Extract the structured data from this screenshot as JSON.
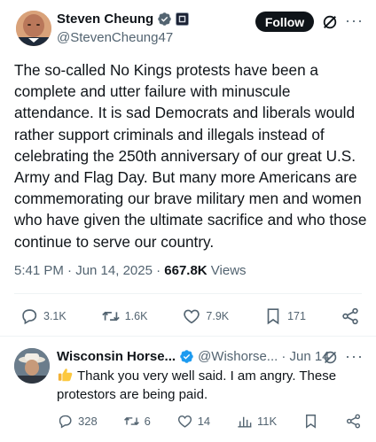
{
  "post": {
    "author_name": "Steven Cheung",
    "author_handle": "@StevenCheung47",
    "follow_label": "Follow",
    "more_label": "···",
    "text": "The so-called No Kings protests have been a complete and utter failure with minuscule attendance. It is sad Democrats and liberals would rather support criminals and illegals instead of celebrating the 250th anniversary of our great U.S. Army and Flag Day. But many more Americans are commemorating our brave military men and women who have given the ultimate sacrifice and who those continue to serve our country.",
    "time": "5:41 PM · Jun 14, 2025 · ",
    "views_count": "667.8K",
    "views_label": " Views",
    "stats": {
      "replies": "3.1K",
      "reposts": "1.6K",
      "likes": "7.9K",
      "bookmarks": "171"
    },
    "icons": [
      "verified-badge-icon",
      "flag-badge-icon",
      "grok-icon",
      "reply-icon",
      "repost-icon",
      "like-icon",
      "bookmark-icon",
      "share-icon"
    ]
  },
  "reply": {
    "author_name": "Wisconsin Horse...",
    "author_handle": "@Wishorse...",
    "date": " · Jun 14",
    "more_label": "···",
    "text": "Thank you very well said.  I am angry.  These protestors are being paid.",
    "stats": {
      "replies": "328",
      "reposts": "6",
      "likes": "14",
      "views": "11K"
    },
    "icons": [
      "thumbs-up-emoji",
      "verified-badge-icon",
      "grok-icon",
      "reply-icon",
      "repost-icon",
      "like-icon",
      "views-icon",
      "bookmark-icon",
      "share-icon"
    ]
  },
  "colors": {
    "text": "#0f1419",
    "secondary": "#536471",
    "verified": "#1d9bf0",
    "divider": "#eff3f4"
  }
}
